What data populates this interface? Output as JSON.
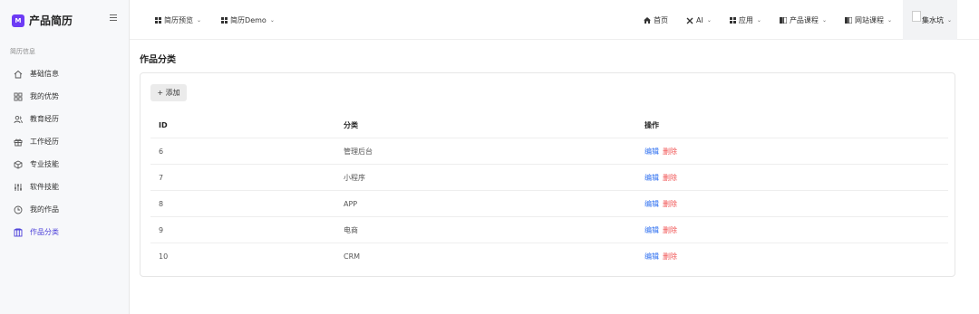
{
  "app": {
    "brand_logo": "M",
    "brand_name": "产品简历"
  },
  "sidebar": {
    "section_label": "简历信息",
    "items": [
      {
        "label": "基础信息",
        "icon": "home-icon"
      },
      {
        "label": "我的优势",
        "icon": "grid-icon"
      },
      {
        "label": "教育经历",
        "icon": "users-icon"
      },
      {
        "label": "工作经历",
        "icon": "gift-icon"
      },
      {
        "label": "专业技能",
        "icon": "cube-icon"
      },
      {
        "label": "软件技能",
        "icon": "sliders-icon"
      },
      {
        "label": "我的作品",
        "icon": "clock-icon"
      },
      {
        "label": "作品分类",
        "icon": "columns-icon",
        "active": true
      }
    ]
  },
  "topbar": {
    "left": [
      {
        "label": "简历预览"
      },
      {
        "label": "简历Demo"
      }
    ],
    "right": [
      {
        "label": "首页"
      },
      {
        "label": "AI"
      },
      {
        "label": "应用"
      },
      {
        "label": "产品课程"
      },
      {
        "label": "网站课程"
      }
    ],
    "user": {
      "name": "集水坑"
    }
  },
  "main": {
    "title": "作品分类",
    "add_button": "+ 添加",
    "table": {
      "headers": {
        "id": "ID",
        "category": "分类",
        "ops": "操作"
      },
      "rows": [
        {
          "id": "6",
          "category": "管理后台"
        },
        {
          "id": "7",
          "category": "小程序"
        },
        {
          "id": "8",
          "category": "APP"
        },
        {
          "id": "9",
          "category": "电商"
        },
        {
          "id": "10",
          "category": "CRM"
        }
      ],
      "edit_label": "编辑",
      "delete_label": "删除"
    }
  },
  "colors": {
    "brand": "#6d3bf5",
    "link": "#2d6ff0",
    "danger": "#f05050",
    "active": "#4b3fd9"
  }
}
